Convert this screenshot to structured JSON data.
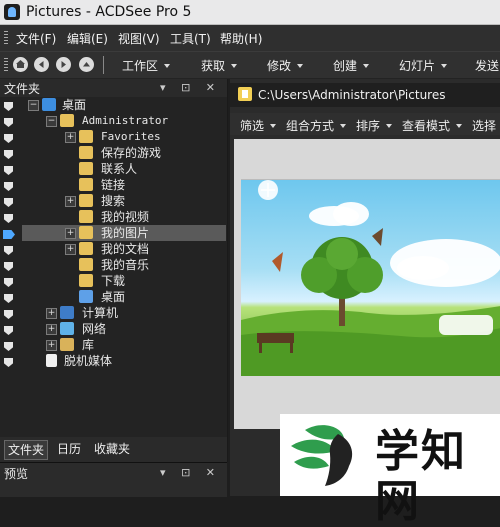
{
  "titlebar": {
    "title": "Pictures - ACDSee Pro 5"
  },
  "menubar": {
    "items": [
      "文件(F)",
      "编辑(E)",
      "视图(V)",
      "工具(T)",
      "帮助(H)"
    ]
  },
  "toolbar": {
    "nav_buttons": [
      "home-icon",
      "back-icon",
      "forward-icon",
      "up-icon"
    ],
    "items": [
      "工作区",
      "获取",
      "修改",
      "创建",
      "幻灯片",
      "发送"
    ]
  },
  "left_panel": {
    "header": "文件夹",
    "tree": [
      {
        "label": "桌面",
        "icon": "desktop-icon"
      },
      {
        "label": "Administrator",
        "icon": "user-folder-icon"
      },
      {
        "label": "Favorites",
        "icon": "folder-icon"
      },
      {
        "label": "保存的游戏",
        "icon": "folder-icon"
      },
      {
        "label": "联系人",
        "icon": "folder-icon"
      },
      {
        "label": "链接",
        "icon": "folder-icon"
      },
      {
        "label": "搜索",
        "icon": "folder-icon"
      },
      {
        "label": "我的视频",
        "icon": "folder-icon"
      },
      {
        "label": "我的图片",
        "icon": "folder-icon"
      },
      {
        "label": "我的文档",
        "icon": "folder-icon"
      },
      {
        "label": "我的音乐",
        "icon": "folder-icon"
      },
      {
        "label": "下载",
        "icon": "folder-icon"
      },
      {
        "label": "桌面",
        "icon": "desktop-folder-icon"
      },
      {
        "label": "计算机",
        "icon": "computer-icon"
      },
      {
        "label": "网络",
        "icon": "network-icon"
      },
      {
        "label": "库",
        "icon": "library-icon"
      },
      {
        "label": "脱机媒体",
        "icon": "document-icon"
      }
    ],
    "tabs": [
      "文件夹",
      "日历",
      "收藏夹"
    ]
  },
  "preview_panel": {
    "header": "预览"
  },
  "right_panel": {
    "path": "C:\\Users\\Administrator\\Pictures",
    "filters": [
      "筛选",
      "组合方式",
      "排序",
      "查看模式",
      "选择"
    ]
  },
  "watermark": {
    "text": "学知网"
  }
}
